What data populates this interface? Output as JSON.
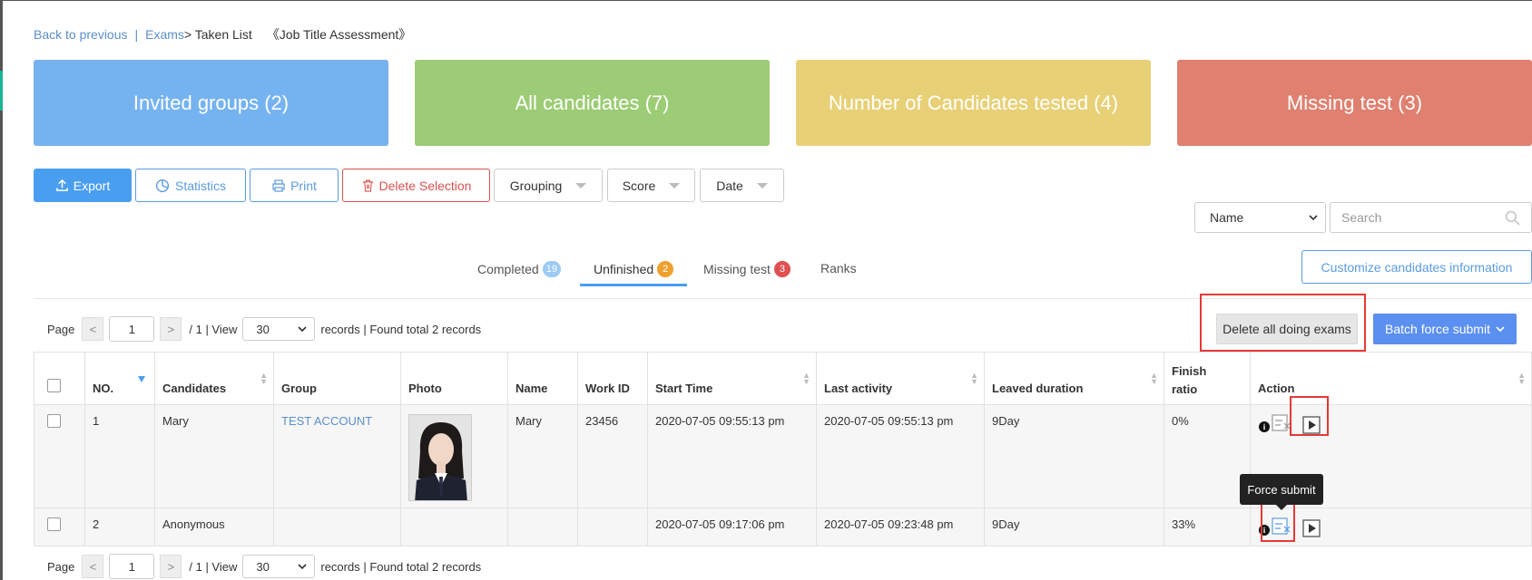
{
  "breadcrumb": {
    "back": "Back to previous",
    "sep": "|",
    "exams": "Exams",
    "current": "> Taken List",
    "exam_title": "《Job Title Assessment》"
  },
  "cards": [
    {
      "label": "Invited groups (2)",
      "color": "#75b3f0"
    },
    {
      "label": "All candidates (7)",
      "color": "#9ccc75"
    },
    {
      "label": "Number of Candidates tested (4)",
      "color": "#e8d077"
    },
    {
      "label": "Missing test (3)",
      "color": "#e08070"
    }
  ],
  "toolbar": {
    "export": "Export",
    "statistics": "Statistics",
    "print": "Print",
    "delete_selection": "Delete Selection",
    "grouping": "Grouping",
    "score": "Score",
    "date": "Date"
  },
  "search": {
    "field_select": "Name",
    "placeholder": "Search"
  },
  "tabs": [
    {
      "label": "Completed",
      "badge": "19"
    },
    {
      "label": "Unfinished",
      "badge": "2",
      "active": true
    },
    {
      "label": "Missing test",
      "badge": "3"
    },
    {
      "label": "Ranks",
      "badge": ""
    }
  ],
  "customize_label": "Customize candidates information",
  "pager": {
    "page_label": "Page",
    "prev": "<",
    "current": "1",
    "next": ">",
    "total": "/ 1 | View",
    "per_page": "30",
    "records": "records | Found total 2 records"
  },
  "actions": {
    "delete_all": "Delete all doing exams",
    "batch_force": "Batch force submit"
  },
  "table": {
    "headers": [
      "NO.",
      "Candidates",
      "Group",
      "Photo",
      "Name",
      "Work ID",
      "Start Time",
      "Last activity",
      "Leaved duration",
      "Finish ratio",
      "Action"
    ],
    "rows": [
      {
        "no": "1",
        "candidate": "Mary",
        "group": "TEST ACCOUNT",
        "has_photo": true,
        "name": "Mary",
        "work_id": "23456",
        "start": "2020-07-05 09:55:13 pm",
        "last": "2020-07-05 09:55:13 pm",
        "leaved": "9Day",
        "ratio": "0%"
      },
      {
        "no": "2",
        "candidate": "Anonymous",
        "group": "",
        "has_photo": false,
        "name": "",
        "work_id": "",
        "start": "2020-07-05 09:17:06 pm",
        "last": "2020-07-05 09:23:48 pm",
        "leaved": "9Day",
        "ratio": "33%"
      }
    ]
  },
  "tooltip": "Force submit",
  "icons": {
    "export": "upload-icon",
    "statistics": "pie-chart-icon",
    "print": "printer-icon",
    "delete": "trash-icon",
    "search": "magnifier-icon",
    "info": "info-icon",
    "force_submit": "force-submit-icon",
    "play": "play-icon"
  },
  "colors": {
    "accent": "#4a9ef0",
    "danger": "#d9534f",
    "highlight_box": "#e53935"
  }
}
